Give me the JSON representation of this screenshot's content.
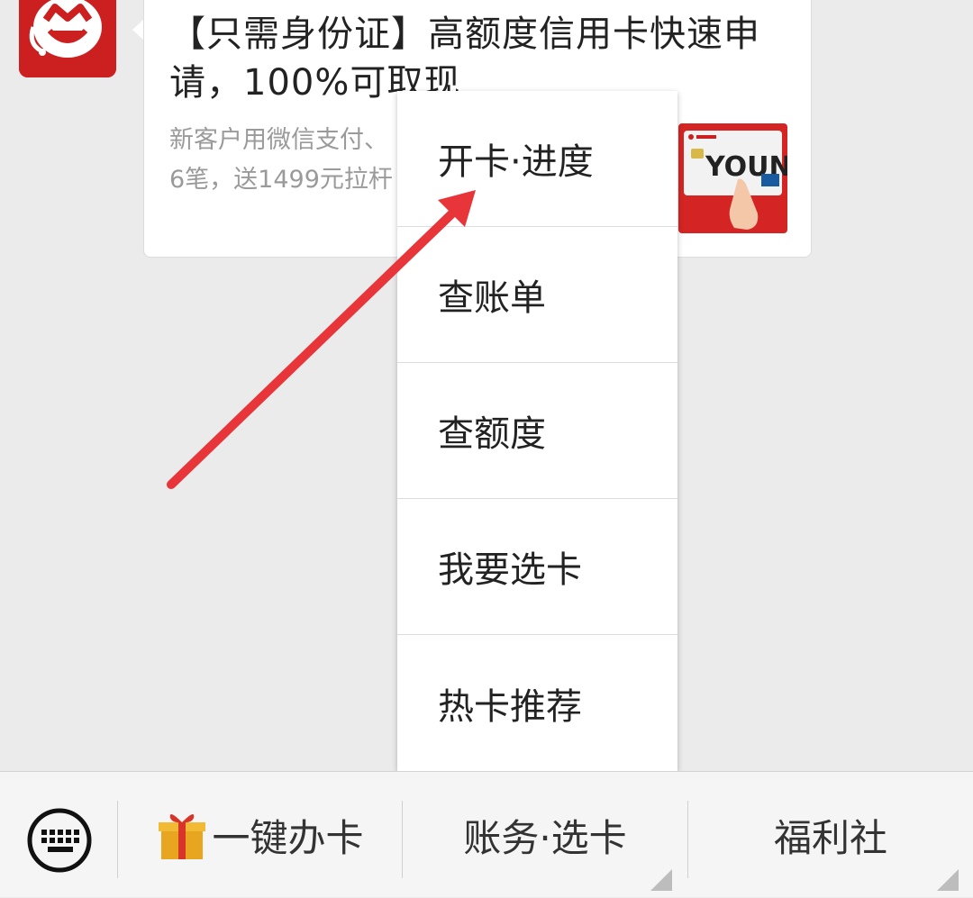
{
  "message_card": {
    "title": "【只需身份证】高额度信用卡快速申请，100%可取现",
    "desc_line1": "新客户用微信支付、",
    "desc_line2": "6笔，送1499元拉杆",
    "thumb_brand_text": "YOUNG"
  },
  "popup_menu": {
    "items": [
      {
        "label": "开卡·进度"
      },
      {
        "label": "查账单"
      },
      {
        "label": "查额度"
      },
      {
        "label": "我要选卡"
      },
      {
        "label": "热卡推荐"
      }
    ]
  },
  "bottom_menu": {
    "keyboard_icon": "keyboard-icon",
    "items": [
      {
        "label": "一键办卡",
        "icon": "gift-icon"
      },
      {
        "label": "账务·选卡"
      },
      {
        "label": "福利社"
      }
    ]
  },
  "colors": {
    "brand_red": "#cc2020",
    "arrow_red": "#e8353a",
    "background": "#ebebeb"
  }
}
